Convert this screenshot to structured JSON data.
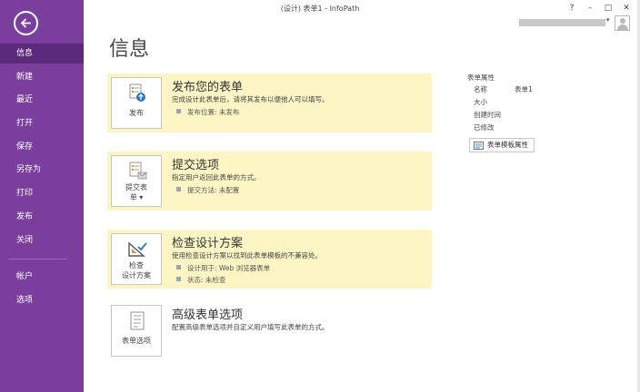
{
  "window": {
    "title": "(设计) 表单1 - InfoPath",
    "controls": {
      "help": "?",
      "minimize": "–",
      "restore": "□",
      "close": "✕"
    }
  },
  "sidebar": {
    "items": [
      {
        "label": "信息",
        "active": true
      },
      {
        "label": "新建"
      },
      {
        "label": "最近"
      },
      {
        "label": "打开"
      },
      {
        "label": "保存"
      },
      {
        "label": "另存为"
      },
      {
        "label": "打印"
      },
      {
        "label": "发布"
      },
      {
        "label": "关闭"
      },
      {
        "label": "帐户"
      },
      {
        "label": "选项"
      }
    ]
  },
  "page": {
    "title": "信息"
  },
  "cards": {
    "publish": {
      "button_label": "发布",
      "title": "发布您的表单",
      "description": "完成设计此表单后，请将其发布以便他人可以填写。",
      "bullets": [
        "发布位置: 未发布"
      ]
    },
    "submit": {
      "button_label_line1": "提交表",
      "button_label_line2": "单 ▾",
      "title": "提交选项",
      "description": "指定用户返回此表单的方式。",
      "bullets": [
        "提交方法: 未配置"
      ]
    },
    "check": {
      "button_label_line1": "检查",
      "button_label_line2": "设计方案",
      "title": "检查设计方案",
      "description": "使用检查设计方案以找到此表单模板的不兼容处。",
      "bullets": [
        "设计用于: Web 浏览器表单",
        "状态: 未检查"
      ]
    },
    "advanced": {
      "button_label": "表单选项",
      "title": "高级表单选项",
      "description": "配置高级表单选项并自定义用户填写此表单的方式。"
    }
  },
  "properties": {
    "heading": "表单属性",
    "rows": [
      {
        "label": "名称",
        "value": "表单1"
      },
      {
        "label": "大小",
        "value": ""
      },
      {
        "label": "创建时间",
        "value": ""
      },
      {
        "label": "已修改",
        "value": ""
      }
    ],
    "template_button": "表单模板属性"
  },
  "colors": {
    "sidebar": "#7a3e9d",
    "sidebar_active": "#5b2a7b",
    "card_highlight": "#fdf6c4"
  }
}
